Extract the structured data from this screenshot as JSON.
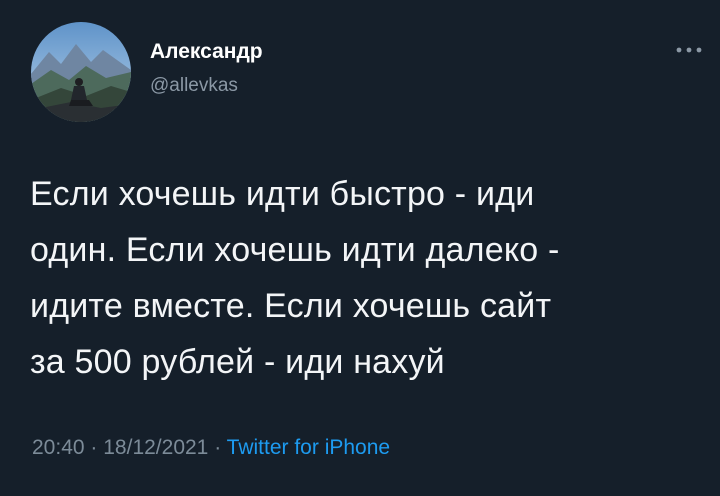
{
  "author": {
    "name": "Александр",
    "handle": "@allevkas"
  },
  "tweet": {
    "lines": [
      "Если хочешь идти быстро - иди",
      "один. Если хочешь идти далеко -",
      "идите вместе. Если хочешь сайт",
      "за 500 рублей - иди нахуй"
    ],
    "time": "20:40",
    "date": "18/12/2021",
    "separator": "·",
    "source": "Twitter for iPhone"
  },
  "icons": {
    "more": "more-horizontal-icon",
    "avatar": "profile-photo-mountains"
  },
  "colors": {
    "background": "#151f2a",
    "text": "#f3f5f7",
    "muted": "#7c8b98",
    "link": "#1d9bf0"
  }
}
